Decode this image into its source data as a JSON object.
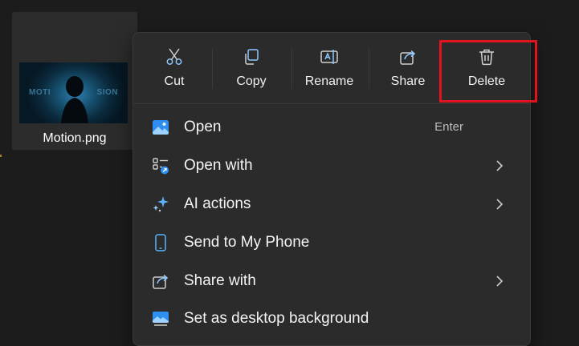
{
  "file": {
    "name": "Motion.png",
    "thumb_left_word": "MOTI",
    "thumb_right_word": "SION"
  },
  "toolbar": {
    "cut_label": "Cut",
    "copy_label": "Copy",
    "rename_label": "Rename",
    "share_label": "Share",
    "delete_label": "Delete"
  },
  "menu": {
    "items": [
      {
        "label": "Open",
        "shortcut": "Enter",
        "icon": "image-icon"
      },
      {
        "label": "Open with",
        "icon": "apps-icon",
        "submenu": true
      },
      {
        "label": "AI actions",
        "icon": "sparkle-icon",
        "submenu": true
      },
      {
        "label": "Send to My Phone",
        "icon": "phone-icon"
      },
      {
        "label": "Share with",
        "icon": "share-icon",
        "submenu": true
      },
      {
        "label": "Set as desktop background",
        "icon": "desktop-background-icon"
      }
    ]
  },
  "colors": {
    "highlight": "#e0141c",
    "accent": "#4aa3ff",
    "menu_bg": "#2b2b2b"
  }
}
